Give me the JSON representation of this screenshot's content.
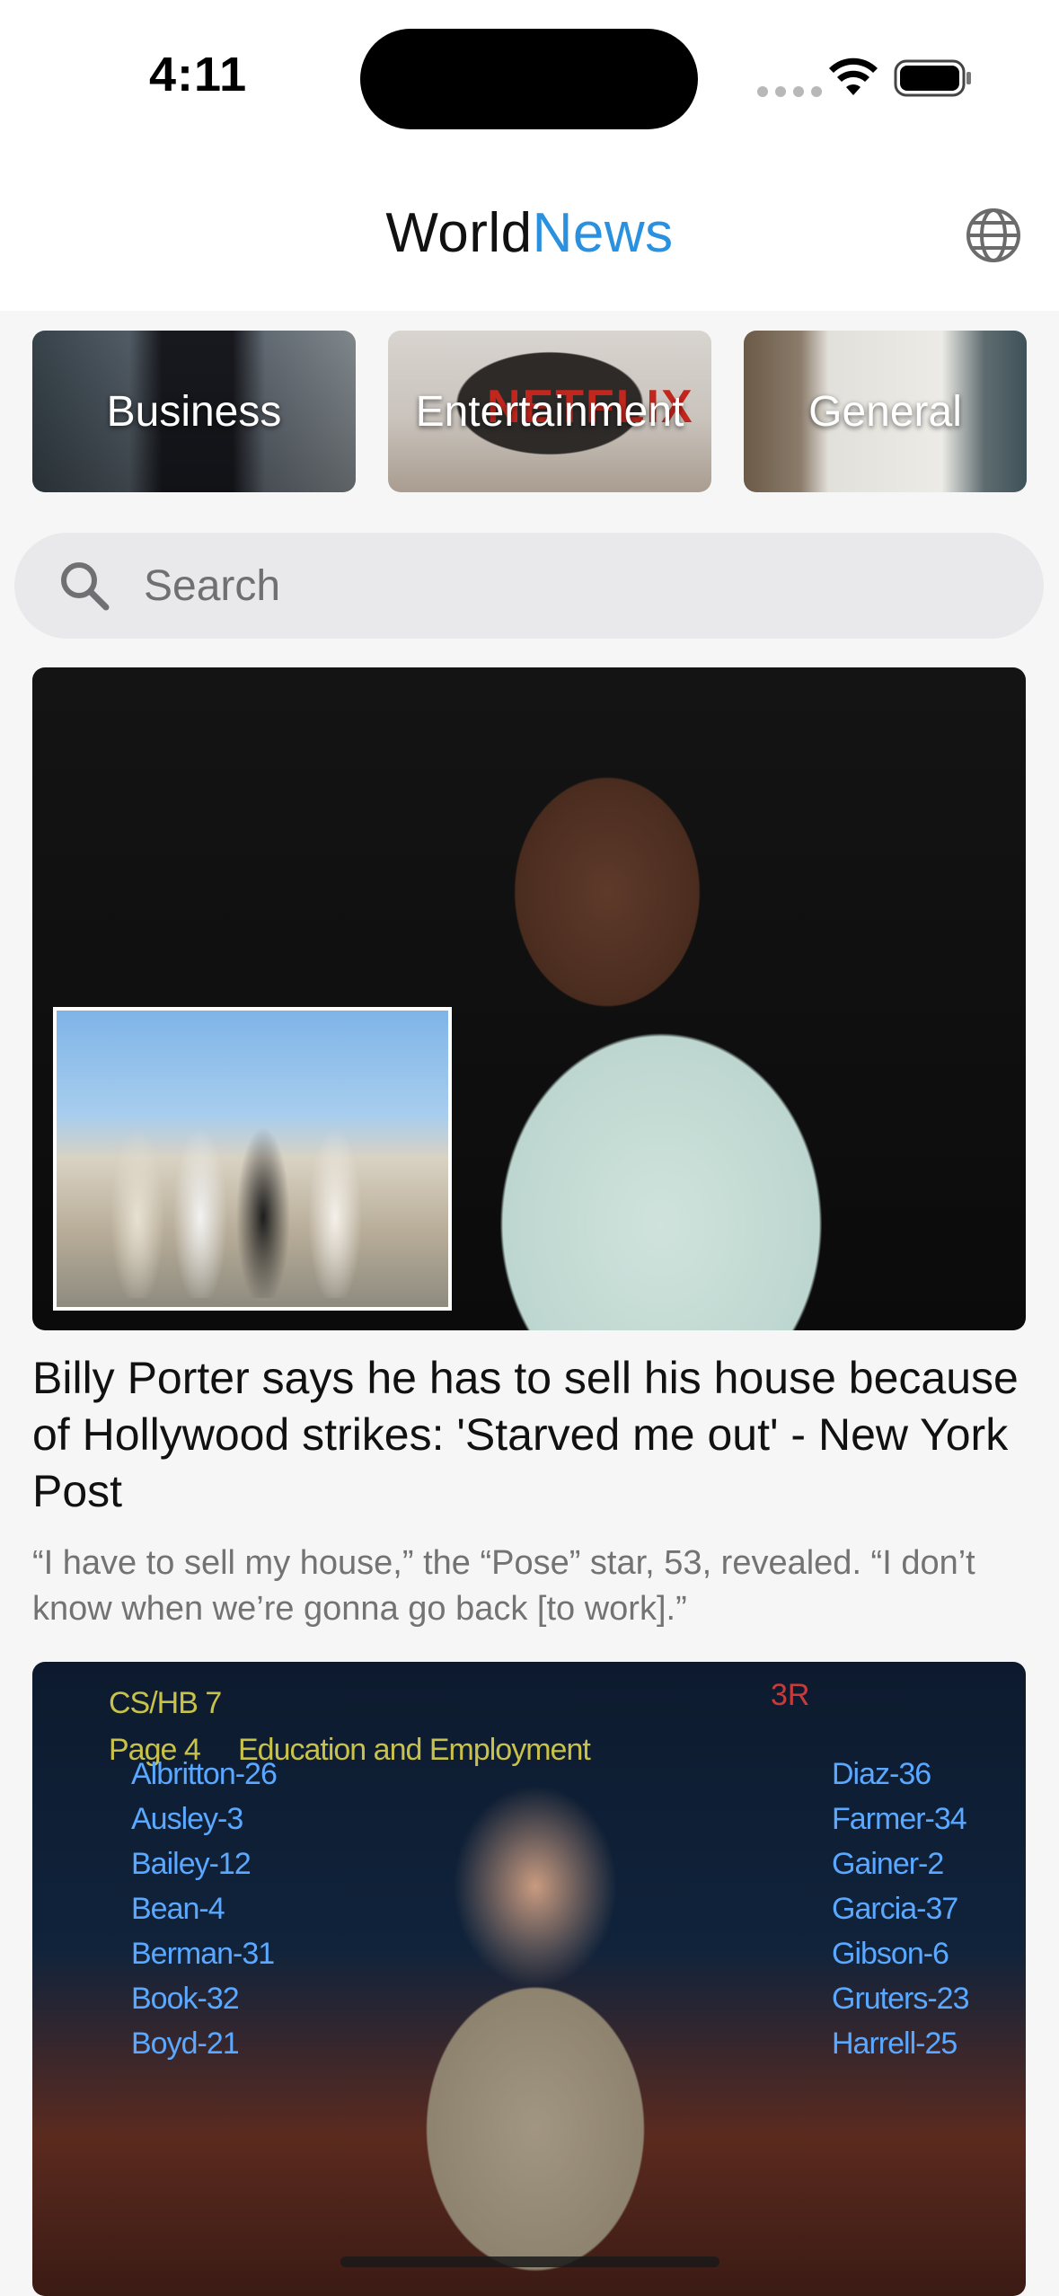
{
  "status_bar": {
    "time": "4:11"
  },
  "header": {
    "title_part1": "World",
    "title_part2": "News",
    "accent_color": "#2a90e0"
  },
  "categories": [
    {
      "label": "Business"
    },
    {
      "label": "Entertainment",
      "overlay_text": "NETFLIX"
    },
    {
      "label": "General"
    }
  ],
  "search": {
    "placeholder": "Search",
    "value": ""
  },
  "articles": [
    {
      "title": "Billy Porter says he has to sell his house because of Hollywood strikes: 'Starved me out' - New York Post",
      "description": "“I have to sell my house,” the “Pose” star, 53, revealed. “I don’t know when we’re gonna go back [to work].”"
    },
    {
      "image_text": {
        "header_line1": "CS/HB 7",
        "header_line2": "Page 4     Education and Employment",
        "badge": "3R",
        "left_column": [
          "Albritton-26",
          "Ausley-3",
          "Bailey-12",
          "Bean-4",
          "Berman-31",
          "Book-32",
          "Boyd-21"
        ],
        "right_column": [
          "Diaz-36",
          "Farmer-34",
          "Gainer-2",
          "Garcia-37",
          "Gibson-6",
          "Gruters-23",
          "Harrell-25"
        ]
      }
    }
  ]
}
